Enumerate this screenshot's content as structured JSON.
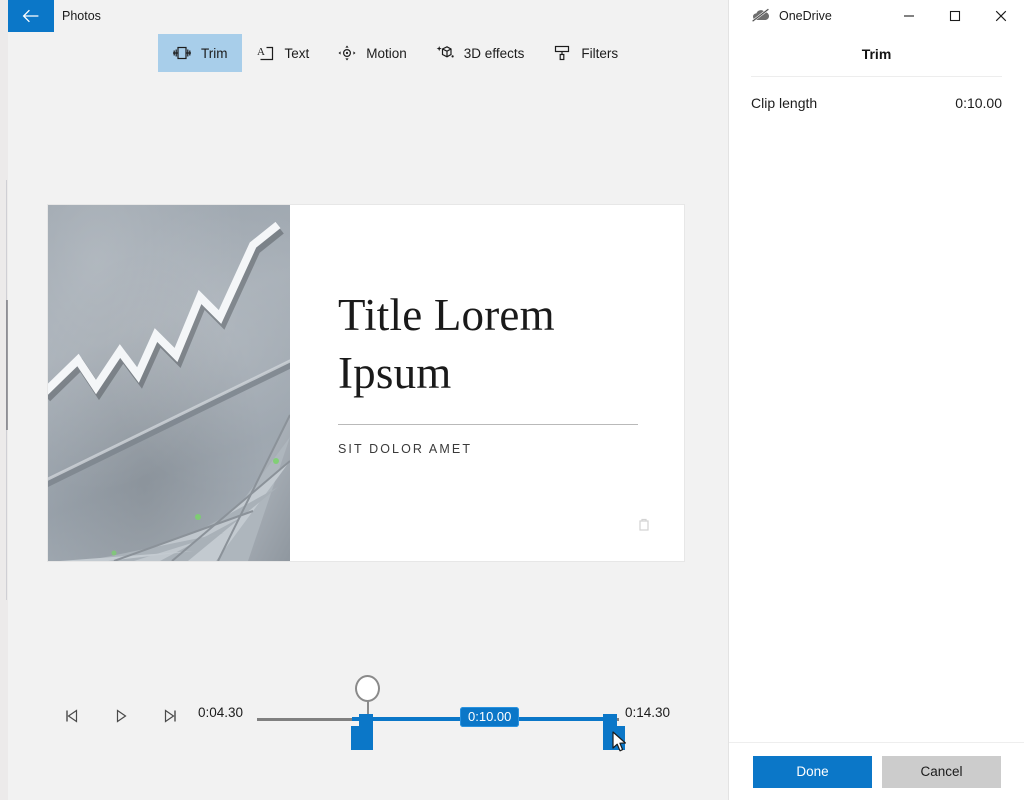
{
  "window": {
    "back_icon": "back-arrow-icon",
    "app_title": "Photos"
  },
  "toolbar": {
    "items": [
      {
        "label": "Trim",
        "icon": "trim-icon",
        "active": true
      },
      {
        "label": "Text",
        "icon": "text-icon",
        "active": false
      },
      {
        "label": "Motion",
        "icon": "motion-icon",
        "active": false
      },
      {
        "label": "3D effects",
        "icon": "cube-sparkle-icon",
        "active": false
      },
      {
        "label": "Filters",
        "icon": "filters-brush-icon",
        "active": false
      }
    ],
    "active_highlight": "#a8ceea"
  },
  "preview": {
    "title": "Title Lorem Ipsum",
    "subtitle": "SIT DOLOR AMET",
    "photo_alt": "concrete-wall-zigzag-arrow-staircase",
    "watermark_icon": "watermark-icon"
  },
  "timeline": {
    "controls": [
      {
        "name": "previous-frame",
        "icon": "previous-frame-icon"
      },
      {
        "name": "play",
        "icon": "play-icon"
      },
      {
        "name": "next-frame",
        "icon": "next-frame-icon"
      }
    ],
    "start_time": "0:04.30",
    "end_time": "0:14.30",
    "selection_badge": "0:10.00",
    "accent_color": "#0b77c8",
    "track_color": "#808080",
    "playhead_icon": "playhead-knob-icon",
    "left_handle_icon": "trim-handle-left-icon",
    "right_handle_icon": "trim-handle-right-icon",
    "cursor_icon": "mouse-cursor-icon"
  },
  "panel": {
    "brand": "OneDrive",
    "brand_icon": "onedrive-paused-cloud-icon",
    "window_buttons": [
      {
        "name": "minimize",
        "icon": "minimize-icon"
      },
      {
        "name": "maximize",
        "icon": "maximize-icon"
      },
      {
        "name": "close",
        "icon": "close-icon"
      }
    ],
    "title": "Trim",
    "rows": [
      {
        "label": "Clip length",
        "value": "0:10.00"
      }
    ],
    "done_label": "Done",
    "cancel_label": "Cancel"
  }
}
